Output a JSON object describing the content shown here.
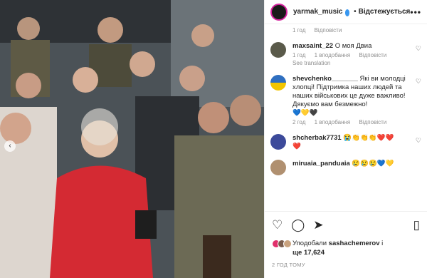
{
  "header": {
    "username": "yarmak_music",
    "dot": "•",
    "follow_label": "Відстежується",
    "more": "•••"
  },
  "comments": {
    "first_meta": {
      "time": "1 год",
      "reply": "Відповісти"
    },
    "items": [
      {
        "user": "maxsaint_22",
        "text": "О моя Двиа",
        "time": "1 год",
        "likes": "1 вподобання",
        "reply": "Відповісти",
        "see_translation": "See translation",
        "avatar_color": "#5a5a4a"
      },
      {
        "user": "shevchenko_______",
        "text": "Які ви молодці хлопці! Підтримка наших людей та наших військових це дуже важливо! Дякуємо вам безмежно!",
        "emoji": "💙💛🖤",
        "time": "2 год",
        "likes": "1 вподобання",
        "reply": "Відповісти",
        "avatar_color": "#2f6fc0"
      },
      {
        "user": "shcherbak7731",
        "text": "😭👏👏👏❤️❤️",
        "emoji": "❤️",
        "time": "",
        "likes": "",
        "reply": "",
        "avatar_color": "#3c4a9a"
      },
      {
        "user": "miruaia_panduaia",
        "text": "😢😢😢💙💛",
        "avatar_color": "#b09070"
      }
    ]
  },
  "actions": {
    "heart_icon": "heart-icon",
    "comment_icon": "comment-icon",
    "share_icon": "share-icon",
    "bookmark_icon": "bookmark-icon",
    "liked_by_prefix": "Уподобали ",
    "liked_by_user": "sashachemerov",
    "liked_by_suffix": " і",
    "likes_more": "ще 17,624",
    "posted": "2 ГОД ТОМУ"
  }
}
